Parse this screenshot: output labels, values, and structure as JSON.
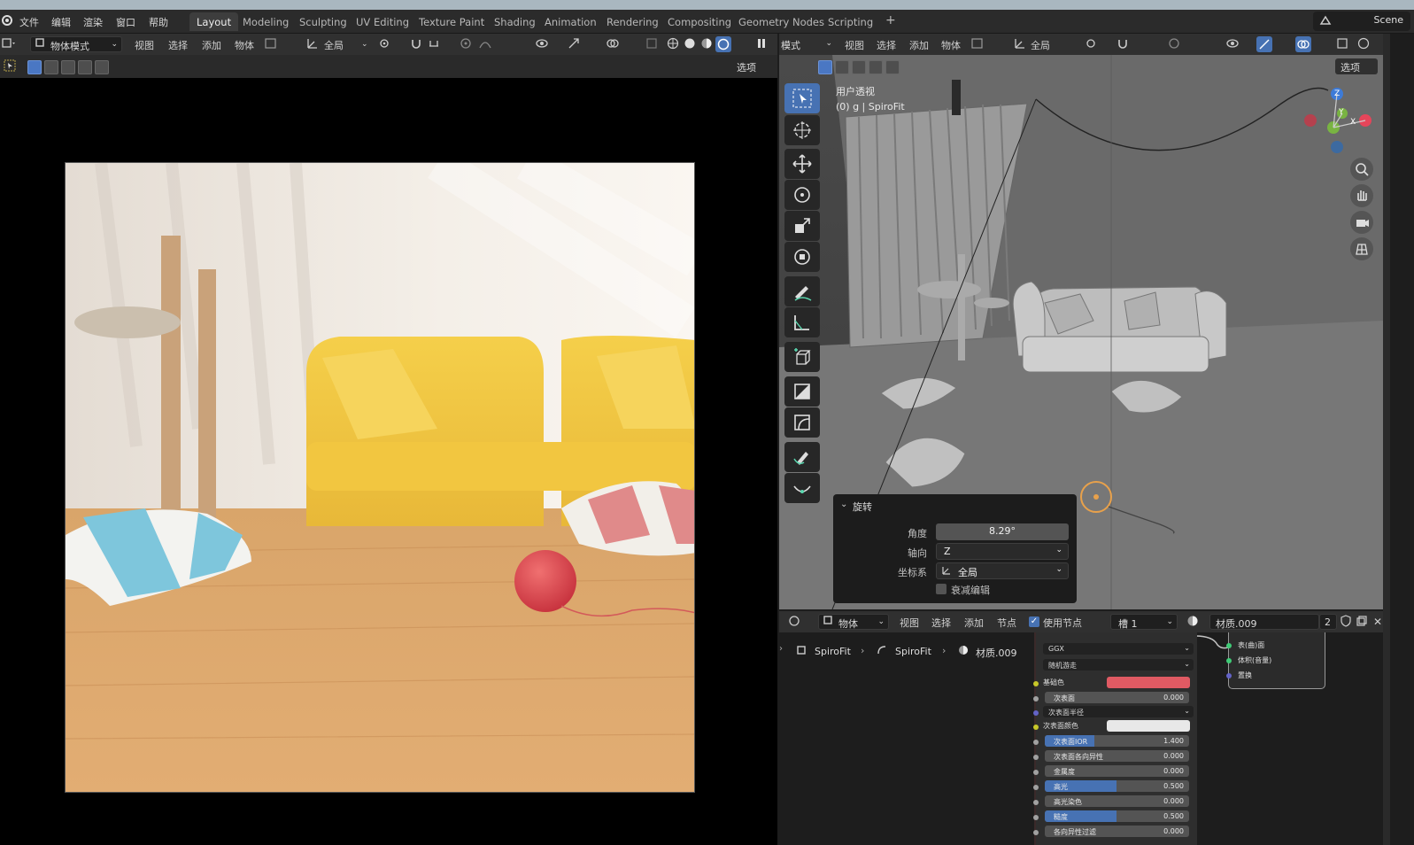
{
  "topbar": {
    "menus": [
      "文件",
      "编辑",
      "渲染",
      "窗口",
      "帮助"
    ],
    "workspaces": [
      "Layout",
      "Modeling",
      "Sculpting",
      "UV Editing",
      "Texture Paint",
      "Shading",
      "Animation",
      "Rendering",
      "Compositing",
      "Geometry Nodes",
      "Scripting"
    ],
    "active_workspace": "Layout",
    "add_tab": "+",
    "scene": "Scene"
  },
  "left_editor": {
    "mode": "物体模式",
    "menu": [
      "视图",
      "选择",
      "添加",
      "物体"
    ],
    "transform_orientation": "全局",
    "options": "选项"
  },
  "viewport": {
    "mode": "模式",
    "menu": [
      "视图",
      "选择",
      "添加",
      "物体"
    ],
    "transform_orientation": "全局",
    "options": "选项",
    "view_name": "用户透视",
    "view_info": "(0) g | SpiroFit",
    "axes": {
      "x": "X",
      "y": "Y",
      "z": "Z"
    }
  },
  "operator_panel": {
    "title": "旋转",
    "angle_label": "角度",
    "angle_value": "8.29°",
    "axis_label": "轴向",
    "axis_value": "Z",
    "coord_label": "坐标系",
    "coord_value": "全局",
    "proportional_label": "衰减编辑",
    "proportional_checked": false
  },
  "node_editor": {
    "type": "物体",
    "menu": [
      "视图",
      "选择",
      "添加",
      "节点"
    ],
    "use_nodes_label": "使用节点",
    "use_nodes": true,
    "slot": "槽 1",
    "material": "材质.009",
    "user_count": "2",
    "breadcrumb": [
      "SpiroFit",
      "SpiroFit",
      "材质.009"
    ]
  },
  "bsdf": {
    "distribution": "GGX",
    "subsurface_method": "随机游走",
    "base_color_label": "基础色",
    "base_color": "#e05a63",
    "subsurface_label": "次表面",
    "subsurface_value": "0.000",
    "subsurface_radius_label": "次表面半径",
    "subsurface_color_label": "次表面颜色",
    "subsurface_color": "#e8e8e8",
    "subsurface_ior_label": "次表面IOR",
    "subsurface_ior_value": "1.400",
    "subsurface_aniso_label": "次表面各向异性",
    "subsurface_aniso_value": "0.000",
    "metallic_label": "金属度",
    "metallic_value": "0.000",
    "specular_label": "高光",
    "specular_value": "0.500",
    "specular_tint_label": "高光染色",
    "specular_tint_value": "0.000",
    "roughness_label": "糙度",
    "roughness_value": "0.500",
    "aniso_label": "各向异性过滤",
    "aniso_value": "0.000"
  },
  "material_output": {
    "surface": "表(曲)面",
    "volume": "体积(音量)",
    "displacement": "置换"
  }
}
